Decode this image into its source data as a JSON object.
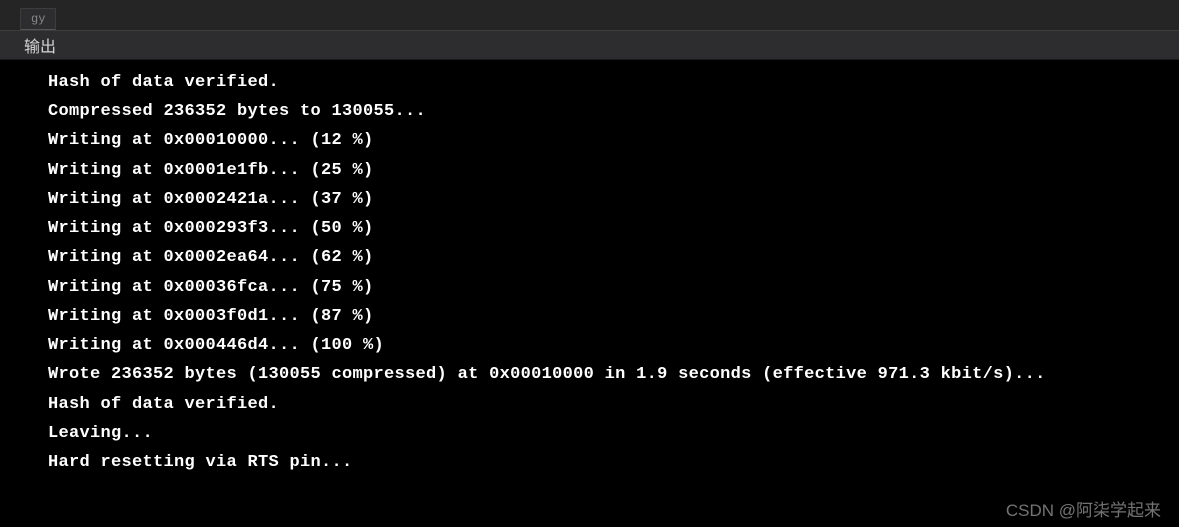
{
  "tabs": {
    "inactive_label": "gy"
  },
  "panel": {
    "active_tab": "输出"
  },
  "terminal": {
    "lines": [
      "Hash of data verified.",
      "Compressed 236352 bytes to 130055...",
      "Writing at 0x00010000... (12 %)",
      "Writing at 0x0001e1fb... (25 %)",
      "Writing at 0x0002421a... (37 %)",
      "Writing at 0x000293f3... (50 %)",
      "Writing at 0x0002ea64... (62 %)",
      "Writing at 0x00036fca... (75 %)",
      "Writing at 0x0003f0d1... (87 %)",
      "Writing at 0x000446d4... (100 %)",
      "Wrote 236352 bytes (130055 compressed) at 0x00010000 in 1.9 seconds (effective 971.3 kbit/s)...",
      "Hash of data verified.",
      "",
      "Leaving...",
      "Hard resetting via RTS pin..."
    ]
  },
  "watermark": "CSDN @阿柒学起来"
}
